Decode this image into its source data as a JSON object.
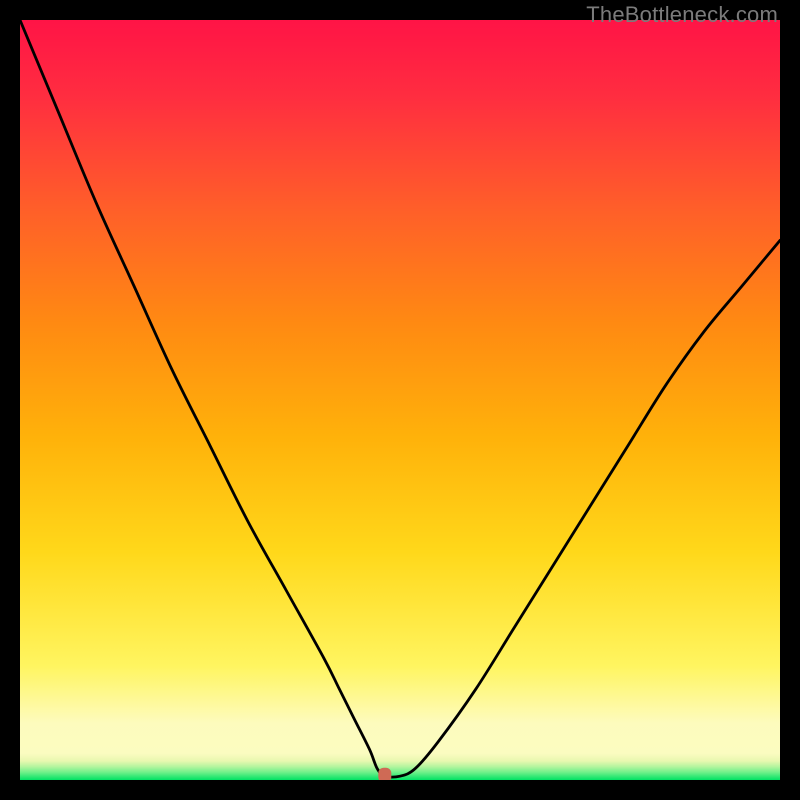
{
  "watermark": "TheBottleneck.com",
  "chart_data": {
    "type": "line",
    "title": "",
    "xlabel": "",
    "ylabel": "",
    "xlim": [
      0,
      100
    ],
    "ylim": [
      0,
      100
    ],
    "series": [
      {
        "name": "curve",
        "x": [
          0,
          5,
          10,
          15,
          20,
          25,
          30,
          35,
          40,
          42,
          44,
          46,
          47,
          48,
          50,
          52,
          55,
          60,
          65,
          70,
          75,
          80,
          85,
          90,
          95,
          100
        ],
        "y": [
          100,
          88,
          76,
          65,
          54,
          44,
          34,
          25,
          16,
          12,
          8,
          4,
          1.5,
          0.5,
          0.5,
          1.5,
          5,
          12,
          20,
          28,
          36,
          44,
          52,
          59,
          65,
          71
        ]
      }
    ],
    "marker": {
      "x": 48,
      "y": 0.5
    },
    "gradient_stops": [
      {
        "offset": 0.0,
        "color": "#00e264"
      },
      {
        "offset": 0.01,
        "color": "#6ef08a"
      },
      {
        "offset": 0.018,
        "color": "#b7f59f"
      },
      {
        "offset": 0.025,
        "color": "#e8f8b0"
      },
      {
        "offset": 0.035,
        "color": "#fbfcc0"
      },
      {
        "offset": 0.075,
        "color": "#fdfbbd"
      },
      {
        "offset": 0.15,
        "color": "#fff560"
      },
      {
        "offset": 0.3,
        "color": "#ffd81a"
      },
      {
        "offset": 0.45,
        "color": "#ffb20a"
      },
      {
        "offset": 0.6,
        "color": "#ff8a12"
      },
      {
        "offset": 0.75,
        "color": "#ff5f29"
      },
      {
        "offset": 0.9,
        "color": "#ff2d40"
      },
      {
        "offset": 1.0,
        "color": "#ff1446"
      }
    ]
  }
}
